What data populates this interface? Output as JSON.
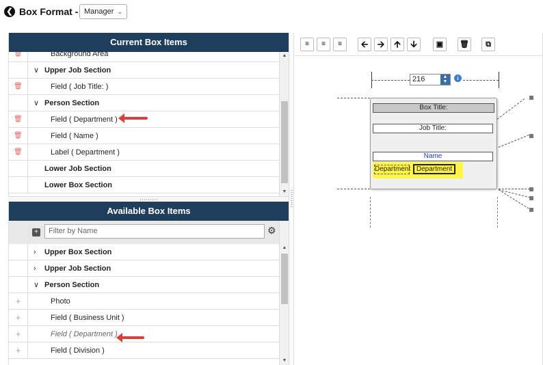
{
  "header": {
    "back_icon": "back-arrow-icon",
    "title": "Box Format -",
    "format_selected": "Manager"
  },
  "current_panel": {
    "title": "Current Box Items",
    "rows": [
      {
        "type": "field",
        "label": "Background Area",
        "gutter": "trash"
      },
      {
        "type": "section",
        "label": "Upper Job Section",
        "expanded": true
      },
      {
        "type": "field",
        "label": "Field  ( Job Title: )",
        "gutter": "trash"
      },
      {
        "type": "section",
        "label": "Person Section",
        "expanded": true
      },
      {
        "type": "field",
        "label": "Field  ( Department )",
        "gutter": "trash"
      },
      {
        "type": "field",
        "label": "Field  ( Name )",
        "gutter": "trash"
      },
      {
        "type": "field",
        "label": "Label  ( Department )",
        "gutter": "trash"
      },
      {
        "type": "section",
        "label": "Lower Job Section"
      },
      {
        "type": "section",
        "label": "Lower Box Section"
      }
    ]
  },
  "available_panel": {
    "title": "Available Box Items",
    "filter_placeholder": "Filter by Name",
    "rows": [
      {
        "type": "section",
        "label": "Upper Box Section",
        "expanded": false
      },
      {
        "type": "section",
        "label": "Upper Job Section",
        "expanded": false
      },
      {
        "type": "section",
        "label": "Person Section",
        "expanded": true
      },
      {
        "type": "field",
        "label": "Photo",
        "gutter": "plus"
      },
      {
        "type": "field",
        "label": "Field  ( Business Unit )",
        "gutter": "plus"
      },
      {
        "type": "field",
        "label": "Field  ( Department )",
        "gutter": "plus",
        "disabled": true
      },
      {
        "type": "field",
        "label": "Field  ( Division )",
        "gutter": "plus"
      }
    ]
  },
  "toolbar": {
    "buttons": [
      "align-left",
      "align-center",
      "align-right",
      "arrow-left",
      "arrow-right",
      "arrow-up",
      "arrow-down",
      "fit-box",
      "delete",
      "copy"
    ]
  },
  "preview": {
    "width_value": "216",
    "box_title": "Box Title:",
    "job_title": "Job Title:",
    "name": "Name",
    "dept_label": "Department",
    "dept_field": "Department",
    "highlight_color": "#fff544"
  },
  "colors": {
    "header_bg": "#1f3e5c",
    "annotation_arrow": "#d9403a",
    "name_text": "#2233cc"
  }
}
